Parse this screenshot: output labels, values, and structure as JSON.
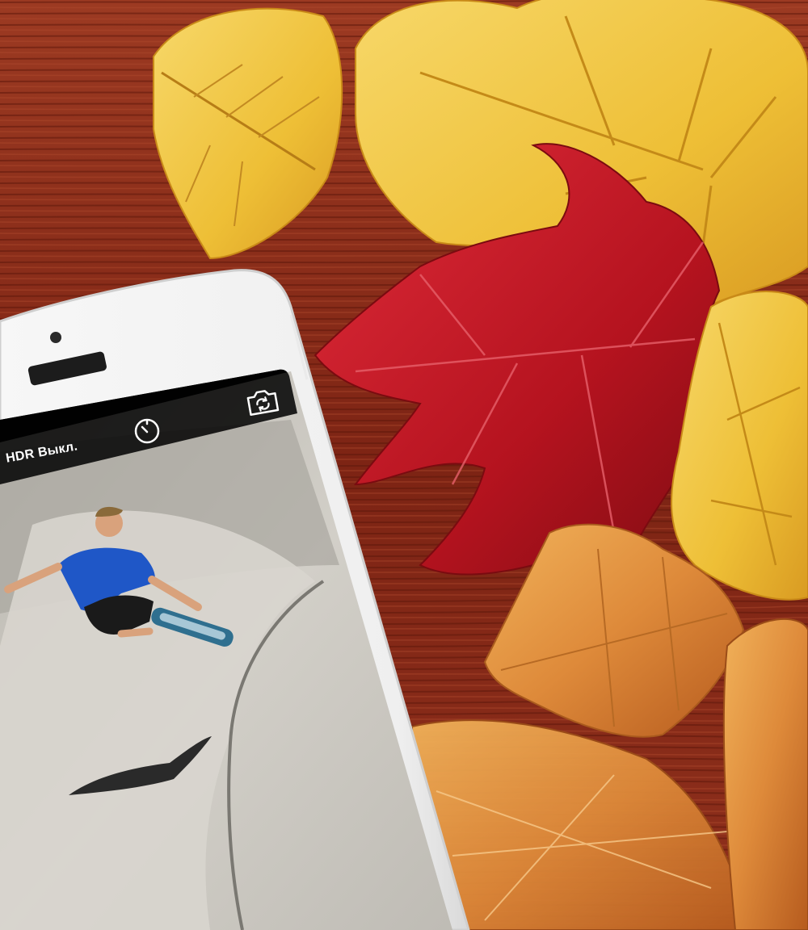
{
  "camera_ui": {
    "hdr_label": "HDR Выкл.",
    "timer_icon": "timer-icon",
    "switch_camera_icon": "switch-camera-icon"
  },
  "colors": {
    "wood": "#8a2a18",
    "leaf_yellow": "#f0c13a",
    "leaf_red": "#b0141e",
    "leaf_orange": "#e08a36",
    "phone_body": "#f4f4f4",
    "phone_bezel": "#0b0b0b",
    "concrete": "#c9c6bf"
  }
}
